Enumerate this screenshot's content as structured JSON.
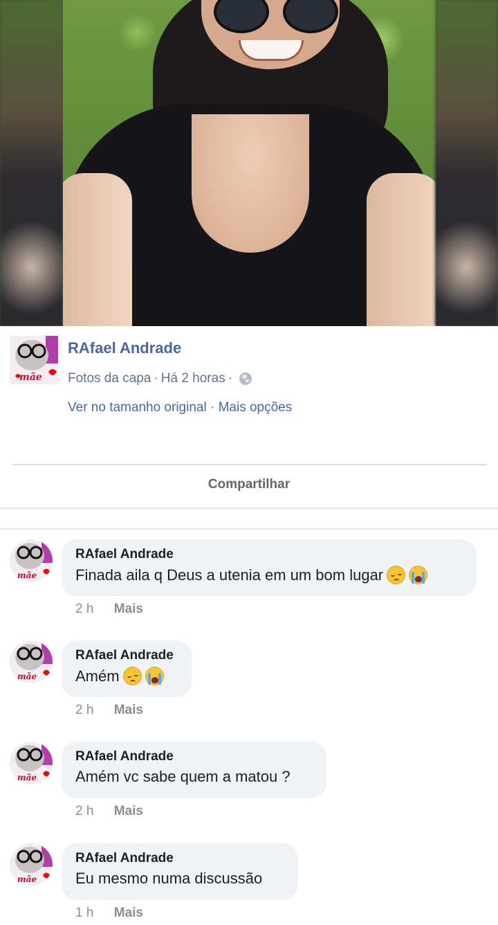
{
  "post": {
    "author": "RAfael Andrade",
    "avatar_label": "mãe",
    "album": "Fotos da capa",
    "separator": "·",
    "time": "Há 2 horas",
    "privacy_icon": "globe-icon",
    "view_original": "Ver no tamanho original",
    "more_options": "Mais opções",
    "share_label": "Compartilhar"
  },
  "comments": [
    {
      "author": "RAfael Andrade",
      "text": "Finada aila q Deus a utenia em um bom lugar",
      "emojis": [
        "pensive-face",
        "loudly-crying-face"
      ],
      "time": "2 h",
      "more": "Mais"
    },
    {
      "author": "RAfael Andrade",
      "text": "Amém",
      "emojis": [
        "pensive-face",
        "loudly-crying-face"
      ],
      "time": "2 h",
      "more": "Mais"
    },
    {
      "author": "RAfael Andrade",
      "text": "Amém vc sabe quem a matou ?",
      "emojis": [],
      "time": "2 h",
      "more": "Mais"
    },
    {
      "author": "RAfael Andrade",
      "text": "Eu mesmo numa discussão",
      "emojis": [],
      "time": "1 h",
      "more": "Mais"
    }
  ],
  "colors": {
    "link_blue": "#4b67a1",
    "meta_gray": "#5f7292",
    "bubble_bg": "#f0f2f5",
    "text_dark": "#1c1e21"
  }
}
